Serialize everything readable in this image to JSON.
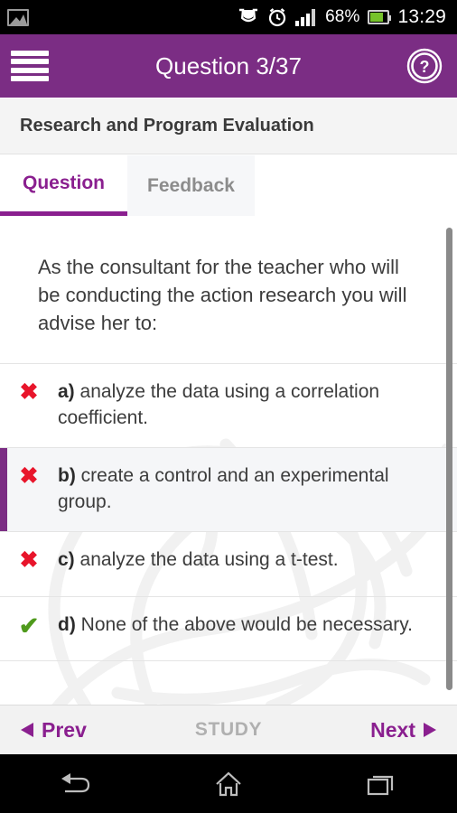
{
  "status_bar": {
    "photo_icon": "image-icon",
    "app_icon": "goal-net-icon",
    "alarm_icon": "alarm-clock-icon",
    "signal_icon": "signal-bars-icon",
    "battery_percent": "68%",
    "battery_icon": "battery-icon",
    "time": "13:29"
  },
  "app_bar": {
    "menu_icon": "hamburger-menu-icon",
    "title": "Question 3/37",
    "help_icon": "help-circle-icon",
    "background": "#7b2d84"
  },
  "subject": {
    "title": "Research and Program Evaluation"
  },
  "tabs": [
    {
      "label": "Question",
      "active": true
    },
    {
      "label": "Feedback",
      "active": false
    }
  ],
  "question": {
    "stem": "As the consultant for the teacher who will be conducting the action research you will advise her to:",
    "options": [
      {
        "letter": "a)",
        "text": "analyze the data using a correlation coefficient.",
        "mark": "incorrect-x-icon",
        "mark_glyph": "✖",
        "selected": false
      },
      {
        "letter": "b)",
        "text": "create a control and an experimental group.",
        "mark": "incorrect-x-icon",
        "mark_glyph": "✖",
        "selected": true
      },
      {
        "letter": "c)",
        "text": "analyze the data using a t-test.",
        "mark": "incorrect-x-icon",
        "mark_glyph": "✖",
        "selected": false
      },
      {
        "letter": "d)",
        "text": "None of the above would be necessary.",
        "mark": "correct-check-icon",
        "mark_glyph": "✔",
        "selected": false
      }
    ]
  },
  "bottom_bar": {
    "prev_label": "Prev",
    "prev_icon": "triangle-left-icon",
    "study_label": "STUDY",
    "next_label": "Next",
    "next_icon": "triangle-right-icon"
  },
  "nav_bar": {
    "back_icon": "back-arrow-icon",
    "home_icon": "home-icon",
    "recents_icon": "recents-square-icon"
  },
  "colors": {
    "brand_purple": "#7b2d84",
    "tab_purple": "#8a1f8f",
    "incorrect_red": "#e8152b",
    "correct_green": "#4f9a1c",
    "selected_bg": "#f5f6f8"
  }
}
